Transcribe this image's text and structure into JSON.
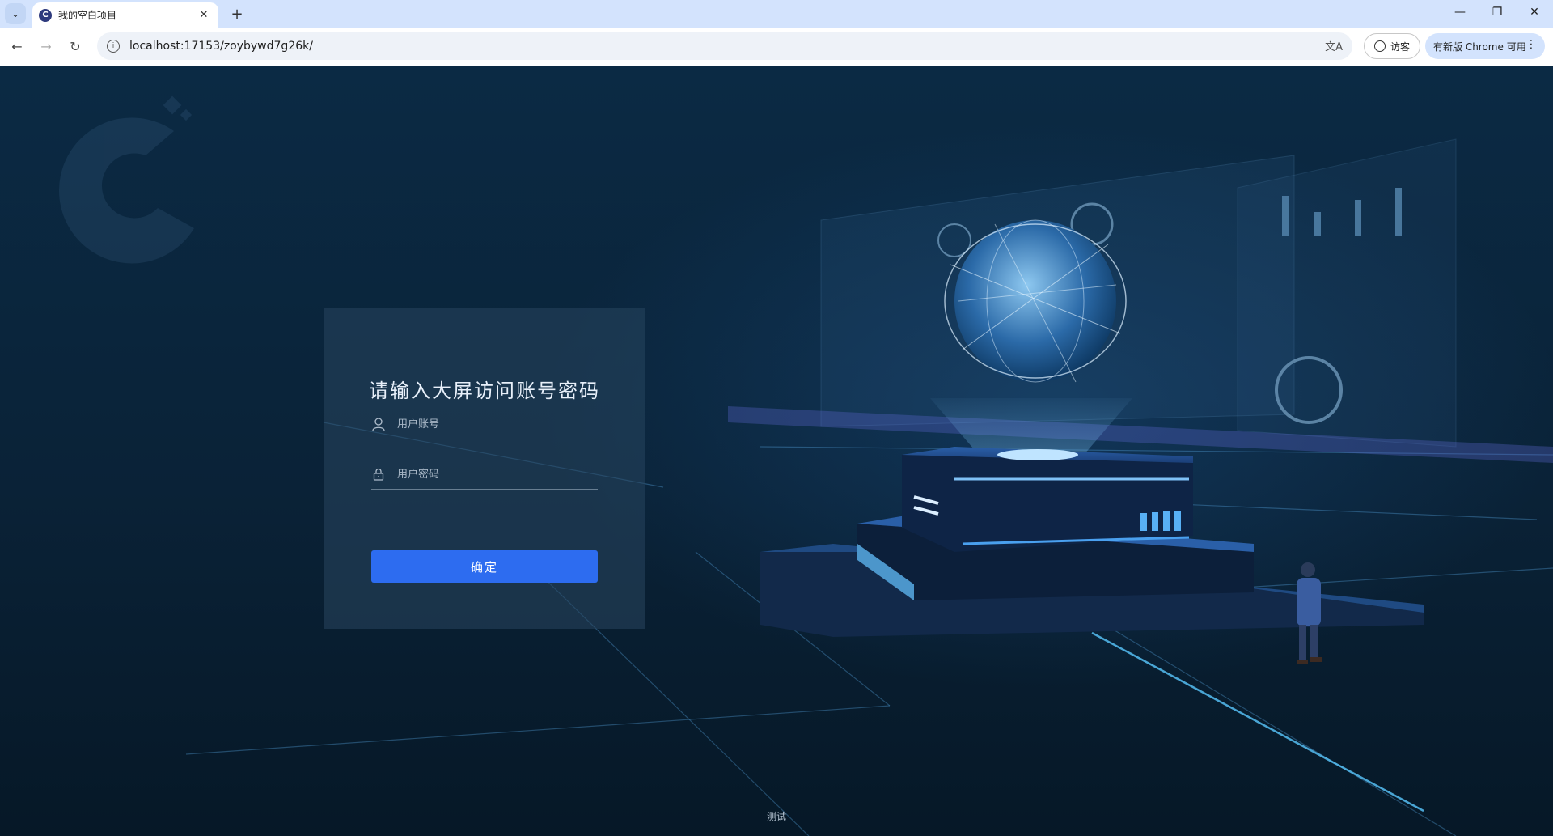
{
  "browser": {
    "tab_title": "我的空白项目",
    "url": "localhost:17153/zoybywd7g26k/",
    "profile_label": "访客",
    "update_label": "有新版 Chrome 可用"
  },
  "login": {
    "title": "请输入大屏访问账号密码",
    "username_placeholder": "用户账号",
    "password_placeholder": "用户密码",
    "submit_label": "确定"
  },
  "footer": {
    "text": "测试"
  },
  "colors": {
    "accent": "#2d6cf0",
    "background": "#0a2236"
  }
}
